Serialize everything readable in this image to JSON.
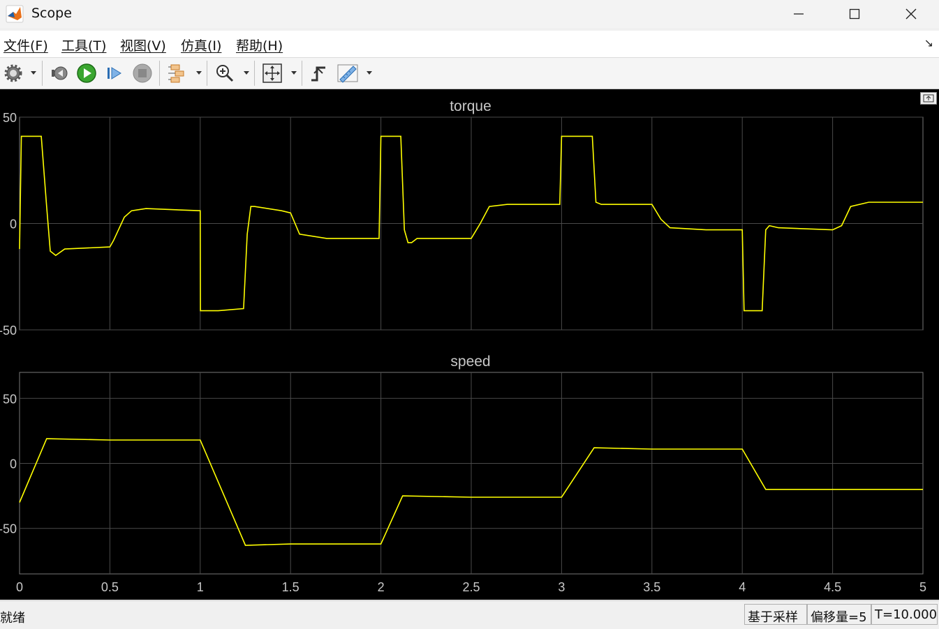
{
  "window": {
    "title": "Scope"
  },
  "menu": {
    "items": [
      "文件(F)",
      "工具(T)",
      "视图(V)",
      "仿真(I)",
      "帮助(H)"
    ]
  },
  "toolbar": {
    "icons": [
      "gear-icon",
      "step-back-icon",
      "run-icon",
      "step-forward-icon",
      "stop-icon",
      "highlight-block-icon",
      "zoom-in-icon",
      "fit-to-view-icon",
      "triggers-icon",
      "measurements-icon"
    ]
  },
  "plots": {
    "torque_title": "torque",
    "speed_title": "speed"
  },
  "chart_data": [
    {
      "type": "line",
      "title": "torque",
      "xlim": [
        0,
        5
      ],
      "ylim": [
        -50,
        50
      ],
      "y_ticks": [
        "50",
        "0",
        "-50"
      ],
      "x_ticks": [],
      "grid": true,
      "color": "#ffff00",
      "series": [
        {
          "x": [
            0,
            0.01,
            0.12,
            0.15,
            0.17,
            0.2,
            0.25,
            0.5,
            0.52,
            0.58,
            0.62,
            0.7,
            1.0,
            1.001,
            1.1,
            1.24,
            1.26,
            1.28,
            1.3,
            1.45,
            1.5,
            1.55,
            1.7,
            1.99,
            2.0,
            2.11,
            2.13,
            2.15,
            2.17,
            2.2,
            2.5,
            2.55,
            2.6,
            2.7,
            2.99,
            3.0,
            3.17,
            3.19,
            3.22,
            3.5,
            3.55,
            3.6,
            3.8,
            4.0,
            4.01,
            4.11,
            4.13,
            4.15,
            4.2,
            4.5,
            4.55,
            4.6,
            4.7,
            5.0
          ],
          "y": [
            -12,
            41,
            41,
            8,
            -13,
            -15,
            -12,
            -11,
            -8,
            3,
            6,
            7,
            6,
            -41,
            -41,
            -40,
            -5,
            8,
            8,
            6,
            5,
            -5,
            -7,
            -7,
            41,
            41,
            -3,
            -9,
            -9,
            -7,
            -7,
            0,
            8,
            9,
            9,
            41,
            41,
            10,
            9,
            9,
            2,
            -2,
            -3,
            -3,
            -41,
            -41,
            -3,
            -1,
            -2,
            -3,
            -1,
            8,
            10,
            10
          ]
        }
      ]
    },
    {
      "type": "line",
      "title": "speed",
      "xlim": [
        0,
        5
      ],
      "ylim": [
        -85,
        70
      ],
      "y_ticks": [
        "50",
        "0",
        "-50"
      ],
      "x_ticks": [
        "0",
        "0.5",
        "1",
        "1.5",
        "2",
        "2.5",
        "3",
        "3.5",
        "4",
        "4.5",
        "5"
      ],
      "grid": true,
      "color": "#ffff00",
      "series": [
        {
          "x": [
            0,
            0.15,
            0.5,
            1.0,
            1.25,
            1.5,
            2.0,
            2.12,
            2.5,
            3.0,
            3.18,
            3.5,
            4.0,
            4.13,
            4.5,
            5.0
          ],
          "y": [
            -30,
            19,
            18,
            18,
            -63,
            -62,
            -62,
            -25,
            -26,
            -26,
            12,
            11,
            11,
            -20,
            -20,
            -20
          ]
        }
      ]
    }
  ],
  "status": {
    "ready": "就绪",
    "sample": "基于采样",
    "offset": "偏移量=5",
    "time": "T=10.000"
  }
}
